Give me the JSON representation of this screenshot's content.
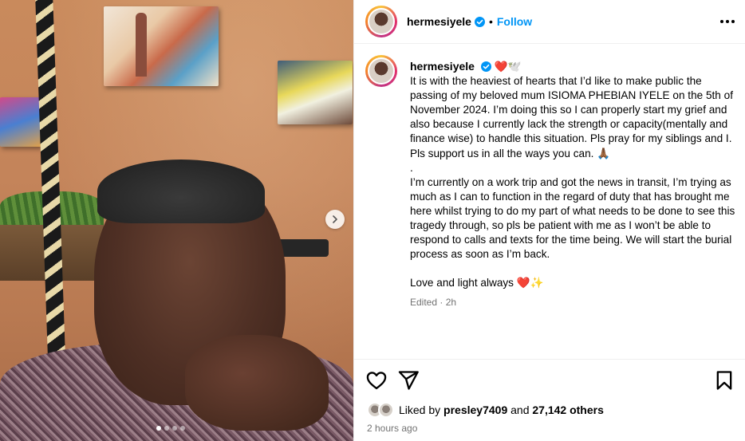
{
  "post": {
    "username": "hermesiyele",
    "follow_label": "Follow",
    "separator": "•",
    "caption_emoji": "❤️🕊️",
    "caption": [
      "It is with the heaviest of hearts that I’d like to make public the passing of my beloved mum ISIOMA PHEBIAN IYELE on the 5th of November 2024. I’m doing this so I can properly start my grief and also because I currently lack the strength or capacity(mentally and finance wise) to handle this situation. Pls pray for my siblings and I. Pls support us in all the ways you can. 🙏🏾",
      ".",
      "I’m currently on a work trip and got the news in transit, I’m trying as much as I can to function in the regard of duty that has brought me here whilst trying to do my part of what needs to be done to see this tragedy through, so pls be patient with me as I won’t be able to respond to calls and texts for the time being. We will start the burial process as soon as I’m back.",
      "Love and light always ❤️✨"
    ],
    "edited": "Edited · 2h",
    "likes": {
      "prefix": "Liked by",
      "user": "presley7409",
      "middle": "and",
      "count": "27,142 others"
    },
    "timestamp": "2 hours ago"
  },
  "carousel": {
    "slide_count": 4,
    "active_index": 0
  },
  "colors": {
    "accent": "#0095f6",
    "verified": "#0095f6",
    "muted": "#737373",
    "border": "#efefef"
  },
  "icons": [
    "verified-icon",
    "more-options-icon",
    "heart-icon",
    "share-icon",
    "bookmark-icon",
    "carousel-next-icon"
  ]
}
